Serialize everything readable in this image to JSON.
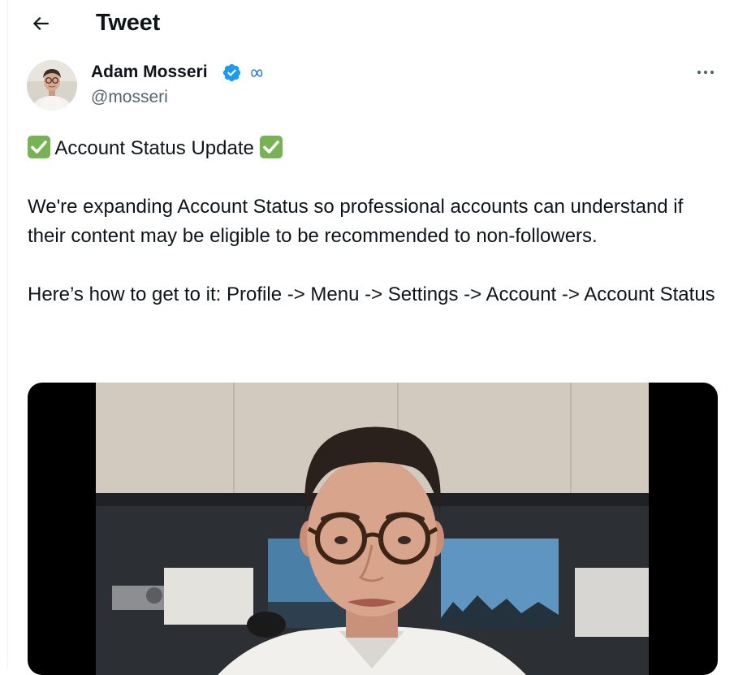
{
  "header": {
    "title": "Tweet",
    "back_icon": "arrow-left-icon"
  },
  "author": {
    "name": "Adam Mosseri",
    "handle": "@mosseri",
    "verified_icon": "verified-badge-icon",
    "affiliation_icon": "meta-logo-icon",
    "verified_color": "#1d9bf0"
  },
  "tweet": {
    "line1_text": "Account Status Update",
    "line1_emoji": "check-mark-button-icon",
    "paragraph2": "We're expanding Account Status so professional accounts can understand if their content may be eligible to be recommended to non-followers.",
    "paragraph3": "Here’s how to get to it: Profile -> Menu -> Settings -> Account -> Account Status",
    "more_icon": "more-horizontal-icon"
  },
  "media": {
    "kind": "video"
  },
  "colors": {
    "text": "#0f1419",
    "secondary": "#536471",
    "accent": "#1d9bf0",
    "check_green": "#77b255"
  }
}
